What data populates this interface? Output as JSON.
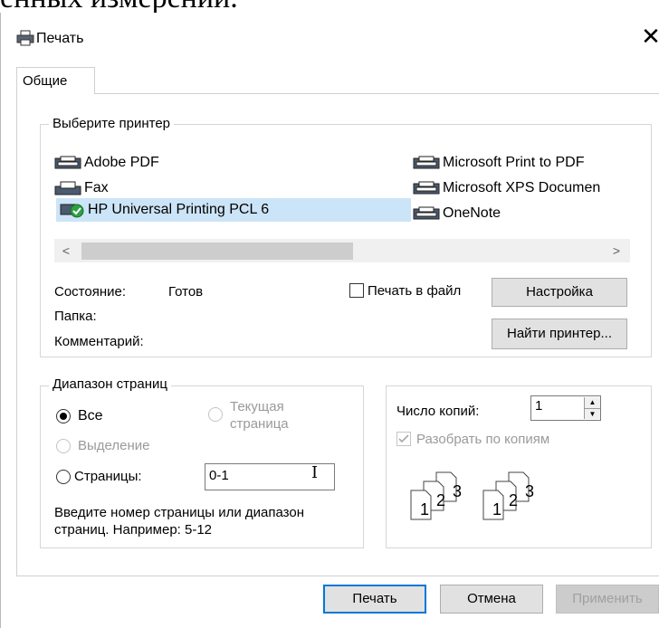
{
  "background_text": "енных измерений.",
  "dialog": {
    "title": "Печать",
    "tab_general": "Общие"
  },
  "printer_section": {
    "label": "Выберите принтер",
    "printers_left": [
      "Adobe PDF",
      "Fax",
      "HP Universal Printing PCL 6"
    ],
    "printers_right": [
      "Microsoft Print to PDF",
      "Microsoft XPS Documen",
      "OneNote"
    ],
    "selected": "HP Universal Printing PCL 6"
  },
  "status": {
    "status_label": "Состояние:",
    "status_value": "Готов",
    "folder_label": "Папка:",
    "comment_label": "Комментарий:",
    "print_to_file": "Печать в файл",
    "settings_button": "Настройка",
    "find_printer_button": "Найти принтер..."
  },
  "page_range": {
    "label": "Диапазон страниц",
    "all": "Все",
    "current_page_line1": "Текущая",
    "current_page_line2": "страница",
    "selection": "Выделение",
    "pages": "Страницы:",
    "pages_value": "0-1",
    "hint_line1": "Введите номер страницы или диапазон",
    "hint_line2": "страниц.  Например: 5-12"
  },
  "copies": {
    "label": "Число копий:",
    "value": "1",
    "collate": "Разобрать по копиям",
    "page_numbers": [
      "1",
      "2",
      "3"
    ]
  },
  "buttons": {
    "print": "Печать",
    "cancel": "Отмена",
    "apply": "Применить"
  },
  "colors": {
    "selection": "#cce4f7",
    "accent": "#0078d7",
    "button_face": "#e1e1e1"
  }
}
